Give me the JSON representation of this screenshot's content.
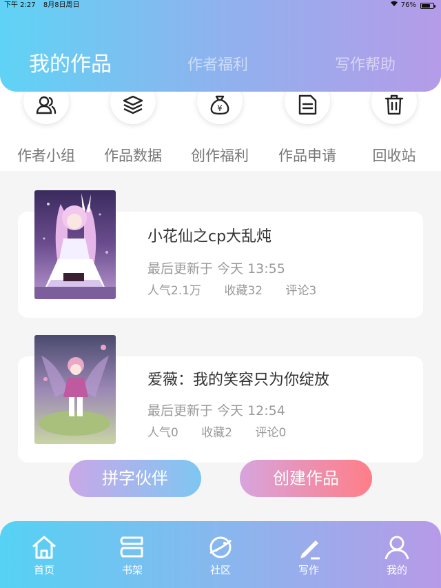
{
  "status_bar": {
    "time": "下午 2:27",
    "date": "8月8日周日",
    "battery": "76%",
    "battery_level": 0.76
  },
  "header": {
    "tabs": [
      {
        "label": "我的作品",
        "active": true
      },
      {
        "label": "作者福利",
        "active": false
      },
      {
        "label": "写作帮助",
        "active": false
      }
    ]
  },
  "quick_actions": [
    {
      "label": "作者小组",
      "icon": "people-icon"
    },
    {
      "label": "作品数据",
      "icon": "layers-icon"
    },
    {
      "label": "创作福利",
      "icon": "money-bag-icon"
    },
    {
      "label": "作品申请",
      "icon": "document-icon"
    },
    {
      "label": "回收站",
      "icon": "trash-icon"
    }
  ],
  "works": [
    {
      "title": "小花仙之cp大乱炖",
      "updated": "最后更新于 今天 13:55",
      "popularity": "人气2.1万",
      "favorites": "收藏32",
      "comments": "评论3"
    },
    {
      "title": "爱薇：我的笑容只为你绽放",
      "updated": "最后更新于 今天 12:54",
      "popularity": "人气0",
      "favorites": "收藏2",
      "comments": "评论0"
    }
  ],
  "actions": {
    "left_button": "拼字伙伴",
    "right_button": "创建作品"
  },
  "bottom_nav": [
    {
      "label": "首页",
      "icon": "home-icon"
    },
    {
      "label": "书架",
      "icon": "bookshelf-icon"
    },
    {
      "label": "社区",
      "icon": "planet-icon"
    },
    {
      "label": "写作",
      "icon": "pen-icon",
      "active": true
    },
    {
      "label": "我的",
      "icon": "user-icon"
    }
  ],
  "colors": {
    "gradient_start": "#5fd3f5",
    "gradient_end": "#b59be8",
    "create_button_end": "#ff7e88"
  }
}
